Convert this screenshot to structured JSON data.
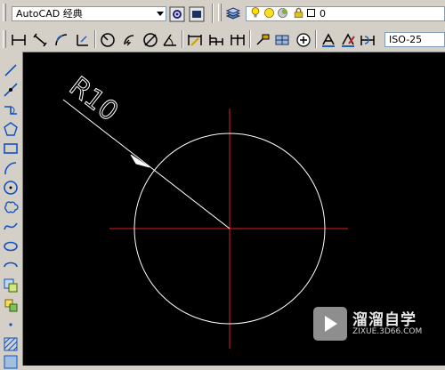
{
  "toolbar_top": {
    "workspace_combo": {
      "value": "AutoCAD 经典"
    },
    "workspace_settings_icon": "gear-icon",
    "layer_combo": {
      "value": "0"
    }
  },
  "toolbar_dimension": {
    "dimstyle_combo": {
      "value": "ISO-25"
    }
  },
  "drawing": {
    "dimension_text": "R10",
    "colors": {
      "geometry": "#ffffff",
      "centerline": "#e11b22",
      "background": "#000000"
    }
  },
  "watermark": {
    "title": "溜溜自学",
    "url": "ZIXUE.3D66.COM"
  }
}
